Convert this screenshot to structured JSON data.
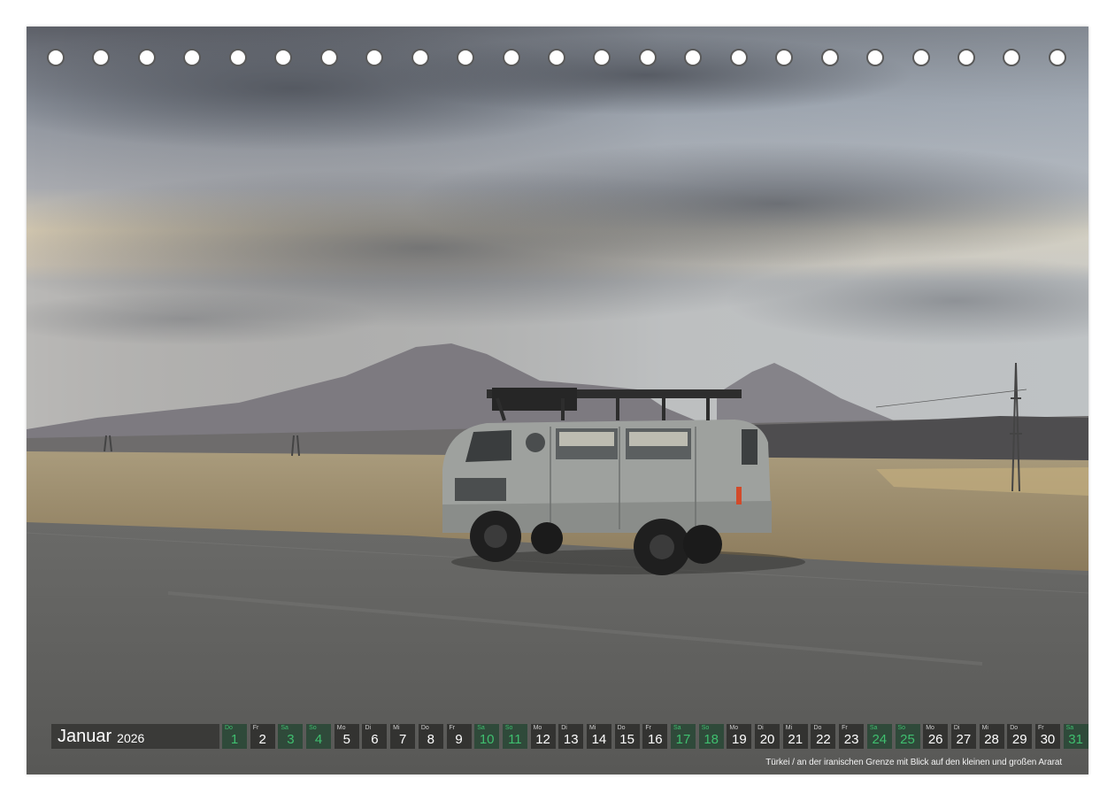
{
  "calendar": {
    "month": "Januar",
    "year": "2026",
    "days": [
      {
        "wd": "Do",
        "num": "1",
        "type": "holiday"
      },
      {
        "wd": "Fr",
        "num": "2",
        "type": "weekday"
      },
      {
        "wd": "Sa",
        "num": "3",
        "type": "weekend"
      },
      {
        "wd": "So",
        "num": "4",
        "type": "weekend"
      },
      {
        "wd": "Mo",
        "num": "5",
        "type": "weekday"
      },
      {
        "wd": "Di",
        "num": "6",
        "type": "weekday"
      },
      {
        "wd": "Mi",
        "num": "7",
        "type": "weekday"
      },
      {
        "wd": "Do",
        "num": "8",
        "type": "weekday"
      },
      {
        "wd": "Fr",
        "num": "9",
        "type": "weekday"
      },
      {
        "wd": "Sa",
        "num": "10",
        "type": "weekend"
      },
      {
        "wd": "So",
        "num": "11",
        "type": "weekend"
      },
      {
        "wd": "Mo",
        "num": "12",
        "type": "weekday"
      },
      {
        "wd": "Di",
        "num": "13",
        "type": "weekday"
      },
      {
        "wd": "Mi",
        "num": "14",
        "type": "weekday"
      },
      {
        "wd": "Do",
        "num": "15",
        "type": "weekday"
      },
      {
        "wd": "Fr",
        "num": "16",
        "type": "weekday"
      },
      {
        "wd": "Sa",
        "num": "17",
        "type": "weekend"
      },
      {
        "wd": "So",
        "num": "18",
        "type": "weekend"
      },
      {
        "wd": "Mo",
        "num": "19",
        "type": "weekday"
      },
      {
        "wd": "Di",
        "num": "20",
        "type": "weekday"
      },
      {
        "wd": "Mi",
        "num": "21",
        "type": "weekday"
      },
      {
        "wd": "Do",
        "num": "22",
        "type": "weekday"
      },
      {
        "wd": "Fr",
        "num": "23",
        "type": "weekday"
      },
      {
        "wd": "Sa",
        "num": "24",
        "type": "weekend"
      },
      {
        "wd": "So",
        "num": "25",
        "type": "weekend"
      },
      {
        "wd": "Mo",
        "num": "26",
        "type": "weekday"
      },
      {
        "wd": "Di",
        "num": "27",
        "type": "weekday"
      },
      {
        "wd": "Mi",
        "num": "28",
        "type": "weekday"
      },
      {
        "wd": "Do",
        "num": "29",
        "type": "weekday"
      },
      {
        "wd": "Fr",
        "num": "30",
        "type": "weekday"
      },
      {
        "wd": "Sa",
        "num": "31",
        "type": "weekend"
      }
    ]
  },
  "caption": "Türkei / an der iranischen Grenze mit Blick auf den kleinen und großen Ararat",
  "colors": {
    "weekend_accent": "#3fbf6f",
    "bar_background": "#333331"
  }
}
